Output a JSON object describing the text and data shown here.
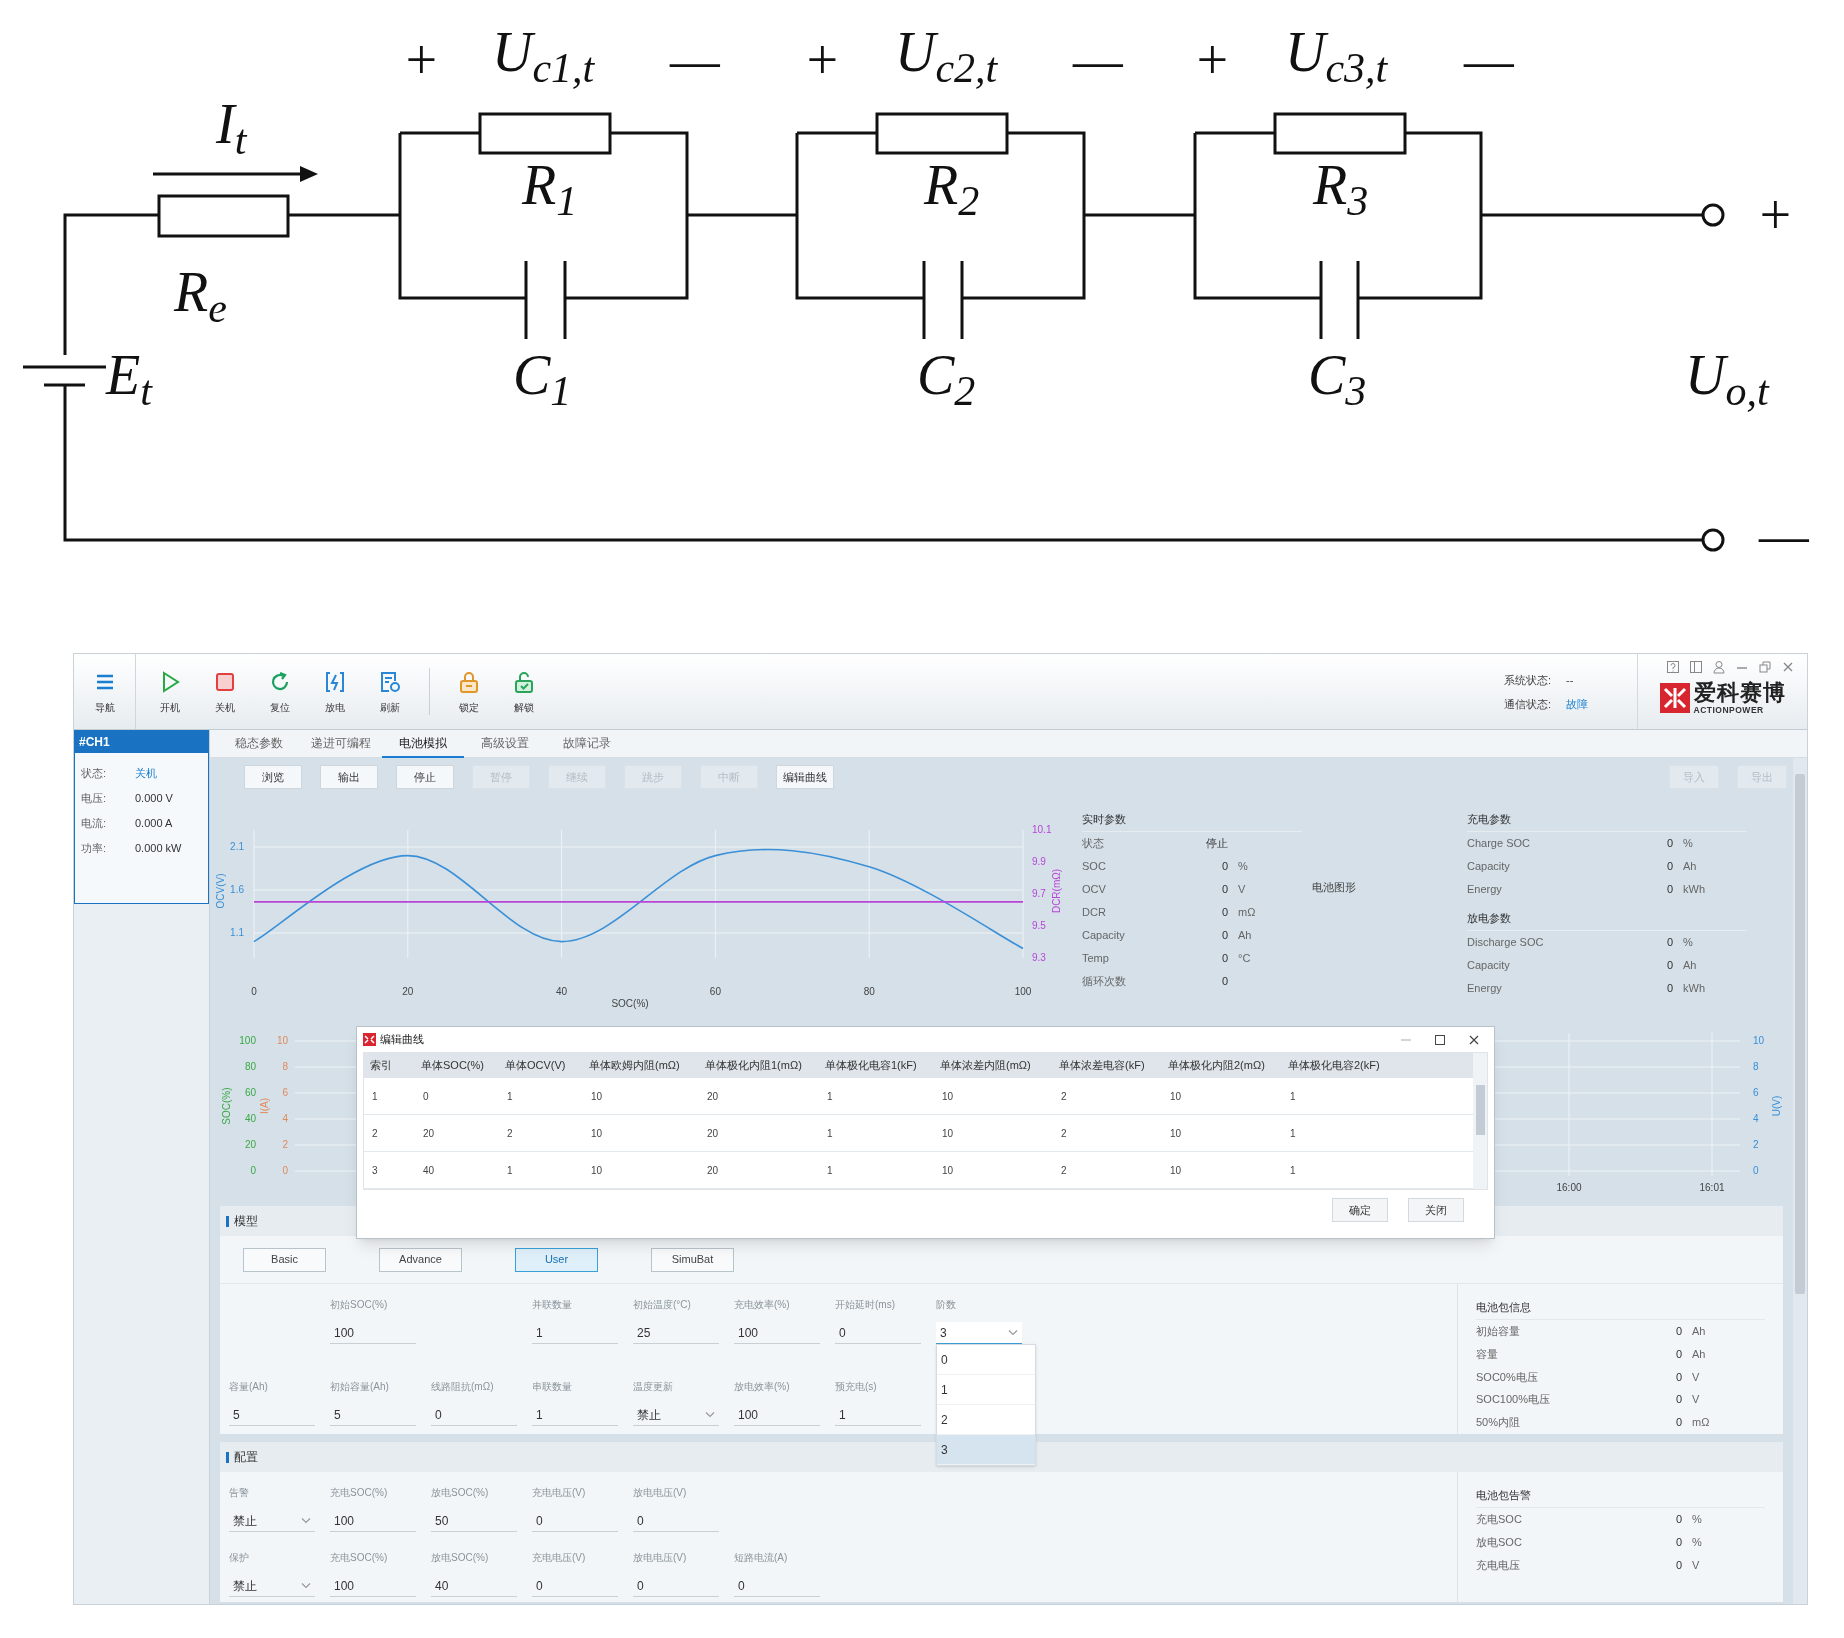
{
  "circuit": {
    "labels": [
      "+",
      "U$_{c1,t}$",
      "—",
      "+",
      "U$_{c2,t}$",
      "—",
      "+",
      "U$_{c3,t}$",
      "—",
      "I$_{t}$",
      "R$_{1}$",
      "R$_{2}$",
      "R$_{3}$",
      "+",
      "R$_{e}$",
      "E$_{t}$",
      "C$_{1}$",
      "C$_{2}$",
      "C$_{3}$",
      "U$_{o,t}$",
      "—"
    ]
  },
  "toolbar": {
    "nav": {
      "label": "导航"
    },
    "buttons": [
      {
        "label": "开机"
      },
      {
        "label": "关机"
      },
      {
        "label": "复位"
      },
      {
        "label": "放电"
      },
      {
        "label": "刷新"
      }
    ],
    "lock_buttons": [
      {
        "label": "锁定"
      },
      {
        "label": "解锁"
      }
    ]
  },
  "status": [
    {
      "label": "系统状态:",
      "value": "--",
      "kind": "plain"
    },
    {
      "label": "通信状态:",
      "value": "故障",
      "kind": "link"
    }
  ],
  "logo": {
    "name": "爱科赛博",
    "tagline": "ACTIONPOWER"
  },
  "channel": {
    "title": "#CH1",
    "rows": [
      {
        "label": "状态:",
        "value": "关机",
        "kind": "status"
      },
      {
        "label": "电压:",
        "value": "0.000 V",
        "kind": "reading"
      },
      {
        "label": "电流:",
        "value": "0.000 A",
        "kind": "reading"
      },
      {
        "label": "功率:",
        "value": "0.000 kW",
        "kind": "reading"
      }
    ]
  },
  "tabs": [
    {
      "label": "稳态参数",
      "selected": false
    },
    {
      "label": "递进可编程",
      "selected": false
    },
    {
      "label": "电池模拟",
      "selected": true
    },
    {
      "label": "高级设置",
      "selected": false
    },
    {
      "label": "故障记录",
      "selected": false
    }
  ],
  "actions": [
    {
      "label": "浏览",
      "disabled": false
    },
    {
      "label": "输出",
      "disabled": false
    },
    {
      "label": "停止",
      "disabled": false
    },
    {
      "label": "暂停",
      "disabled": true
    },
    {
      "label": "继续",
      "disabled": true
    },
    {
      "label": "跳步",
      "disabled": true
    },
    {
      "label": "中断",
      "disabled": true
    },
    {
      "label": "编辑曲线",
      "disabled": false
    }
  ],
  "io_buttons": [
    {
      "label": "导入",
      "disabled": true
    },
    {
      "label": "导出",
      "disabled": true
    }
  ],
  "ocv_chart": {
    "chart_data": {
      "type": "line",
      "xlabel": "SOC(%)",
      "ylabel": "OCV(V)",
      "x": [
        0,
        20,
        40,
        60,
        80,
        100
      ],
      "series": [
        {
          "color": "#3a8fd6",
          "values": [
            1,
            2,
            1,
            2,
            1.87,
            0.92
          ]
        },
        {
          "color": "#b845d8",
          "axis": "y2",
          "values": [
            9.65,
            9.65,
            9.65,
            9.65,
            9.65,
            9.65
          ]
        }
      ],
      "xticks": [
        0,
        20,
        40,
        60,
        80,
        100
      ],
      "xlim": [
        0,
        100
      ],
      "yticks": [
        1.1,
        1.6,
        2.1
      ],
      "ylim": [
        0.81,
        2.3
      ],
      "grid": true,
      "y2label": "DCR(mΩ)",
      "y2ticks": [
        9.3,
        9.5,
        9.7,
        9.9,
        10.1
      ],
      "y2lim": [
        9.3,
        10.1
      ]
    }
  },
  "realtime": {
    "title": "实时参数",
    "rows": [
      {
        "label": "状态",
        "value": "停止"
      },
      {
        "label": "SOC",
        "value": "0",
        "unit": "%"
      },
      {
        "label": "OCV",
        "value": "0",
        "unit": "V"
      },
      {
        "label": "DCR",
        "value": "0",
        "unit": "mΩ"
      },
      {
        "label": "Capacity",
        "value": "0",
        "unit": "Ah"
      },
      {
        "label": "Temp",
        "value": "0",
        "unit": "°C"
      },
      {
        "label": "循环次数",
        "value": "0"
      }
    ]
  },
  "battery_graphic_label": "电池图形",
  "charge": {
    "title": "充电参数",
    "rows": [
      {
        "label": "Charge SOC",
        "value": "0",
        "unit": "%"
      },
      {
        "label": "Capacity",
        "value": "0",
        "unit": "Ah"
      },
      {
        "label": "Energy",
        "value": "0",
        "unit": "kWh"
      }
    ]
  },
  "discharge": {
    "title": "放电参数",
    "rows": [
      {
        "label": "Discharge SOC",
        "value": "0",
        "unit": "%"
      },
      {
        "label": "Capacity",
        "value": "0",
        "unit": "Ah"
      },
      {
        "label": "Energy",
        "value": "0",
        "unit": "kWh"
      }
    ]
  },
  "trend_chart": {
    "soc_label": "SOC(%)",
    "soc_ticks": [
      "100",
      "80",
      "60",
      "40",
      "20",
      "0"
    ],
    "current_label": "I(A)",
    "current_ticks": [
      "10",
      "8",
      "6",
      "4",
      "2",
      "0"
    ],
    "voltage_label": "U(V)",
    "voltage_ticks": [
      "10",
      "8",
      "6",
      "4",
      "2",
      "0"
    ],
    "time_ticks": [
      "16:00",
      "16:01"
    ]
  },
  "model": {
    "title": "模型",
    "types": [
      {
        "label": "Basic",
        "selected": false
      },
      {
        "label": "Advance",
        "selected": false
      },
      {
        "label": "User",
        "selected": true
      },
      {
        "label": "SimuBat",
        "selected": false
      }
    ],
    "rows": [
      [
        "",
        {
          "label": "初始SOC(%)",
          "value": "100",
          "kind": "input"
        },
        "",
        {
          "label": "并联数量",
          "value": "1",
          "kind": "input"
        },
        {
          "label": "初始温度(°C)",
          "value": "25",
          "kind": "input"
        },
        {
          "label": "充电效率(%)",
          "value": "100",
          "kind": "input"
        },
        {
          "label": "开始延时(ms)",
          "value": "0",
          "kind": "input"
        },
        {
          "label": "阶数",
          "value": "3",
          "kind": "select",
          "expanded": true,
          "options": [
            {
              "label": "0",
              "selected": false
            },
            {
              "label": "1",
              "selected": false
            },
            {
              "label": "2",
              "selected": false
            },
            {
              "label": "3",
              "selected": true
            }
          ]
        }
      ],
      [
        {
          "label": "容量(Ah)",
          "value": "5",
          "kind": "input"
        },
        {
          "label": "初始容量(Ah)",
          "value": "5",
          "kind": "input"
        },
        {
          "label": "线路阻抗(mΩ)",
          "value": "0",
          "kind": "input"
        },
        {
          "label": "串联数量",
          "value": "1",
          "kind": "input"
        },
        {
          "label": "温度更新",
          "value": "禁止",
          "kind": "select",
          "expanded": false
        },
        {
          "label": "放电效率(%)",
          "value": "100",
          "kind": "input"
        },
        {
          "label": "预充电(s)",
          "value": "1",
          "kind": "input"
        }
      ]
    ],
    "info": {
      "title": "电池包信息",
      "rows": [
        {
          "label": "初始容量",
          "value": "0",
          "unit": "Ah"
        },
        {
          "label": "容量",
          "value": "0",
          "unit": "Ah"
        },
        {
          "label": "SOC0%电压",
          "value": "0",
          "unit": "V"
        },
        {
          "label": "SOC100%电压",
          "value": "0",
          "unit": "V"
        },
        {
          "label": "50%内阻",
          "value": "0",
          "unit": "mΩ"
        }
      ]
    }
  },
  "protection": {
    "title": "配置",
    "rows": [
      [
        {
          "label": "告警",
          "value": "禁止",
          "kind": "select",
          "expanded": false
        },
        {
          "label": "充电SOC(%)",
          "value": "100",
          "kind": "input"
        },
        {
          "label": "放电SOC(%)",
          "value": "50",
          "kind": "input"
        },
        {
          "label": "充电电压(V)",
          "value": "0",
          "kind": "input"
        },
        {
          "label": "放电电压(V)",
          "value": "0",
          "kind": "input"
        }
      ],
      [
        {
          "label": "保护",
          "value": "禁止",
          "kind": "select",
          "expanded": false
        },
        {
          "label": "充电SOC(%)",
          "value": "100",
          "kind": "input"
        },
        {
          "label": "放电SOC(%)",
          "value": "40",
          "kind": "input"
        },
        {
          "label": "充电电压(V)",
          "value": "0",
          "kind": "input"
        },
        {
          "label": "放电电压(V)",
          "value": "0",
          "kind": "input"
        },
        {
          "label": "短路电流(A)",
          "value": "0",
          "kind": "input"
        }
      ]
    ],
    "info": {
      "title": "电池包告警",
      "rows": [
        {
          "label": "充电SOC",
          "value": "0",
          "unit": "%"
        },
        {
          "label": "放电SOC",
          "value": "0",
          "unit": "%"
        },
        {
          "label": "充电电压",
          "value": "0",
          "unit": "V"
        }
      ]
    }
  },
  "dialog": {
    "title": "编辑曲线",
    "columns": [
      "索引",
      "单体SOC(%)",
      "单体OCV(V)",
      "单体欧姆内阻(mΩ)",
      "单体极化内阻1(mΩ)",
      "单体极化电容1(kF)",
      "单体浓差内阻(mΩ)",
      "单体浓差电容(kF)",
      "单体极化内阻2(mΩ)",
      "单体极化电容2(kF)"
    ],
    "rows": [
      [
        "1",
        "0",
        "1",
        "10",
        "20",
        "1",
        "10",
        "2",
        "10",
        "1"
      ],
      [
        "2",
        "20",
        "2",
        "10",
        "20",
        "1",
        "10",
        "2",
        "10",
        "1"
      ],
      [
        "3",
        "40",
        "1",
        "10",
        "20",
        "1",
        "10",
        "2",
        "10",
        "1"
      ]
    ],
    "buttons": [
      "确定",
      "关闭"
    ]
  }
}
